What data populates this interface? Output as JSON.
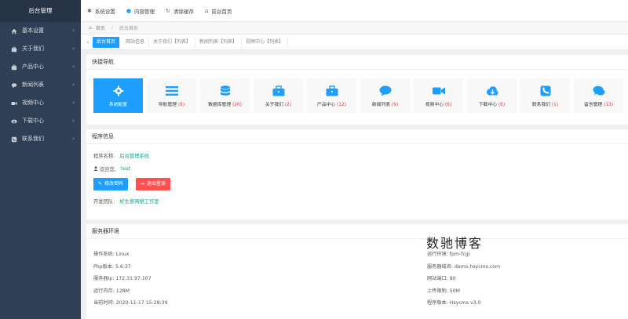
{
  "sidebar": {
    "logo": "后台管理",
    "items": [
      {
        "label": "基本设置",
        "icon": "home-icon"
      },
      {
        "label": "关于我们",
        "icon": "briefcase-icon"
      },
      {
        "label": "产品中心",
        "icon": "briefcase-icon"
      },
      {
        "label": "新闻列表",
        "icon": "comment-icon"
      },
      {
        "label": "视频中心",
        "icon": "video-icon"
      },
      {
        "label": "下载中心",
        "icon": "cloud-download-icon"
      },
      {
        "label": "联系我们",
        "icon": "phone-icon"
      }
    ]
  },
  "topbar": {
    "items": [
      {
        "label": "系统设置",
        "icon": "gear-icon"
      },
      {
        "label": "内容管理",
        "icon": "comment-icon"
      },
      {
        "label": "清除缓存",
        "icon": "refresh-icon"
      },
      {
        "label": "前台首页",
        "icon": "home-icon"
      }
    ]
  },
  "breadcrumb": {
    "home": "首页",
    "current": "后台首页"
  },
  "tabs": [
    {
      "label": "后台首页"
    },
    {
      "label": "网站信息"
    },
    {
      "label": "关于我们【列表】"
    },
    {
      "label": "新闻列表【列表】"
    },
    {
      "label": "视频中心【列表】"
    }
  ],
  "quicknav": {
    "title": "快捷导航",
    "cards": [
      {
        "label": "系统配置",
        "count": "",
        "icon": "gear-icon",
        "color": "#ffffff"
      },
      {
        "label": "导航管理",
        "count": "(8)",
        "icon": "bars-icon",
        "color": "#1e9fff"
      },
      {
        "label": "数据库管理",
        "count": "(20)",
        "icon": "database-icon",
        "color": "#1e9fff"
      },
      {
        "label": "关于我们",
        "count": "(2)",
        "icon": "briefcase-icon",
        "color": "#1e9fff"
      },
      {
        "label": "产品中心",
        "count": "(12)",
        "icon": "briefcase-icon",
        "color": "#1e9fff"
      },
      {
        "label": "新闻列表",
        "count": "(9)",
        "icon": "comment-icon",
        "color": "#1e9fff"
      },
      {
        "label": "视频中心",
        "count": "(6)",
        "icon": "video-icon",
        "color": "#1e9fff"
      },
      {
        "label": "下载中心",
        "count": "(6)",
        "icon": "cloud-download-icon",
        "color": "#1e9fff"
      },
      {
        "label": "联系我们",
        "count": "(1)",
        "icon": "phone-icon",
        "color": "#1e9fff"
      },
      {
        "label": "留言管理",
        "count": "(13)",
        "icon": "comments-icon",
        "color": "#1e9fff"
      }
    ]
  },
  "program": {
    "title": "程序信息",
    "name_label": "程序名称:",
    "name_value": "后台管理系统",
    "welcome_label": "欢迎您,",
    "welcome_value": "test",
    "btn_password": "修改密码",
    "btn_logout": "退出登录",
    "team_label": "开发团队:",
    "team_value": "好生意网络工作室"
  },
  "server": {
    "title": "服务器环境",
    "left": [
      "操作系统: Linux",
      "Php版本: 5.6.37",
      "服务器Ip: 172.31.97.107",
      "运行内存: 128M",
      "当前时间: 2020-11-17 15:28:39"
    ],
    "right": [
      "运行环境: fpm-fcgi",
      "服务器域名: demo.hsycms.com",
      "网站端口: 80",
      "上传限制: 50M",
      "程序版本: Hsycms v3.0"
    ]
  },
  "watermark": "数驰博客",
  "colors": {
    "accent": "#1e9fff",
    "sidebar": "#2f4056",
    "danger": "#ff5151",
    "link": "#15a38a"
  }
}
